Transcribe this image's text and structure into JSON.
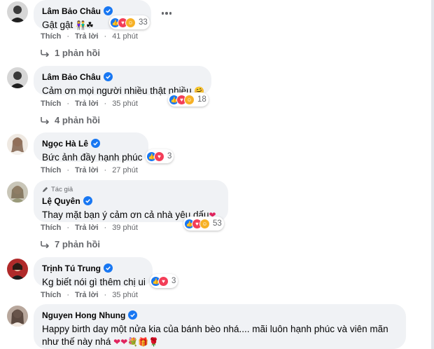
{
  "actions": {
    "like": "Thích",
    "reply": "Trả lời"
  },
  "author_tag": "Tác giả",
  "comments": [
    {
      "name": "Lâm Bảo Châu",
      "text": "Gật gật",
      "text_emoji": "👫☘",
      "reactions": "33",
      "time": "41 phút",
      "replies": "1 phản hồi"
    },
    {
      "name": "Lâm Bảo Châu",
      "text": "Cảm ơn mọi người nhiều thật nhiều",
      "text_emoji": "🤗",
      "reactions": "18",
      "time": "35 phút",
      "replies": "4 phản hồi"
    },
    {
      "name": "Ngọc Hà Lê",
      "text": "Bức ảnh đầy hạnh phúc",
      "text_emoji": "",
      "reactions": "3",
      "time": "27 phút"
    },
    {
      "name": "Lệ Quyên",
      "text": "Thay mặt bạn ý cảm ơn cả nhà yêu dấu",
      "text_emoji": "❤",
      "reactions": "53",
      "time": "39 phút",
      "replies": "7 phản hồi"
    },
    {
      "name": "Trịnh Tú Trung",
      "text": "Kg biết nói gì thêm chị ui",
      "text_emoji": "",
      "reactions": "3",
      "time": "35 phút"
    },
    {
      "name": "Nguyen Hong Nhung",
      "text": "Happy birth day một nửa kia của bánh bèo nhá.... mãi luôn hạnh phúc và viên mãn như thế này nhá",
      "text_emoji": "❤❤💐🎁🌹"
    }
  ],
  "colors": {
    "bubble": "#f0f2f5",
    "like": "#1877f2",
    "love": "#f33e58",
    "care": "#f7b125",
    "muted": "#65676b"
  }
}
